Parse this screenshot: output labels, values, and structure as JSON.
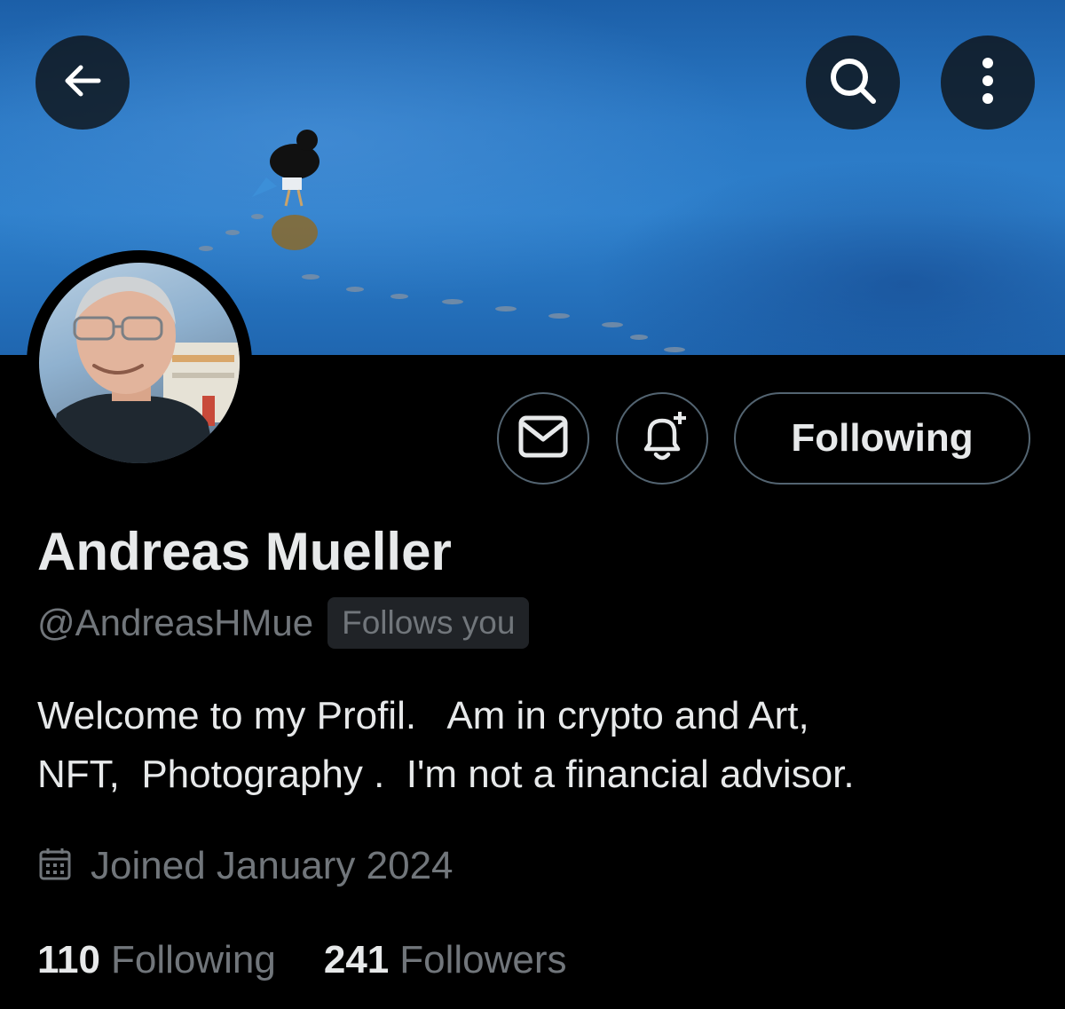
{
  "header": {
    "back_icon": "arrow-left-icon",
    "search_icon": "search-icon",
    "more_icon": "more-vertical-icon"
  },
  "profile": {
    "name": "Andreas Mueller",
    "handle": "@AndreasHMue",
    "follows_you_badge": "Follows you",
    "bio": "Welcome to my Profil.   Am in crypto and Art,\nNFT,  Photography .  I'm not a financial advisor.",
    "joined": "Joined January 2024",
    "following_count": "110",
    "following_label": "Following",
    "followers_count": "241",
    "followers_label": "Followers"
  },
  "actions": {
    "message_icon": "mail-icon",
    "notify_icon": "bell-plus-icon",
    "follow_state_label": "Following"
  },
  "colors": {
    "background": "#000000",
    "primary_text": "#e7e9ea",
    "secondary_text": "#71767b",
    "border": "#536471"
  }
}
